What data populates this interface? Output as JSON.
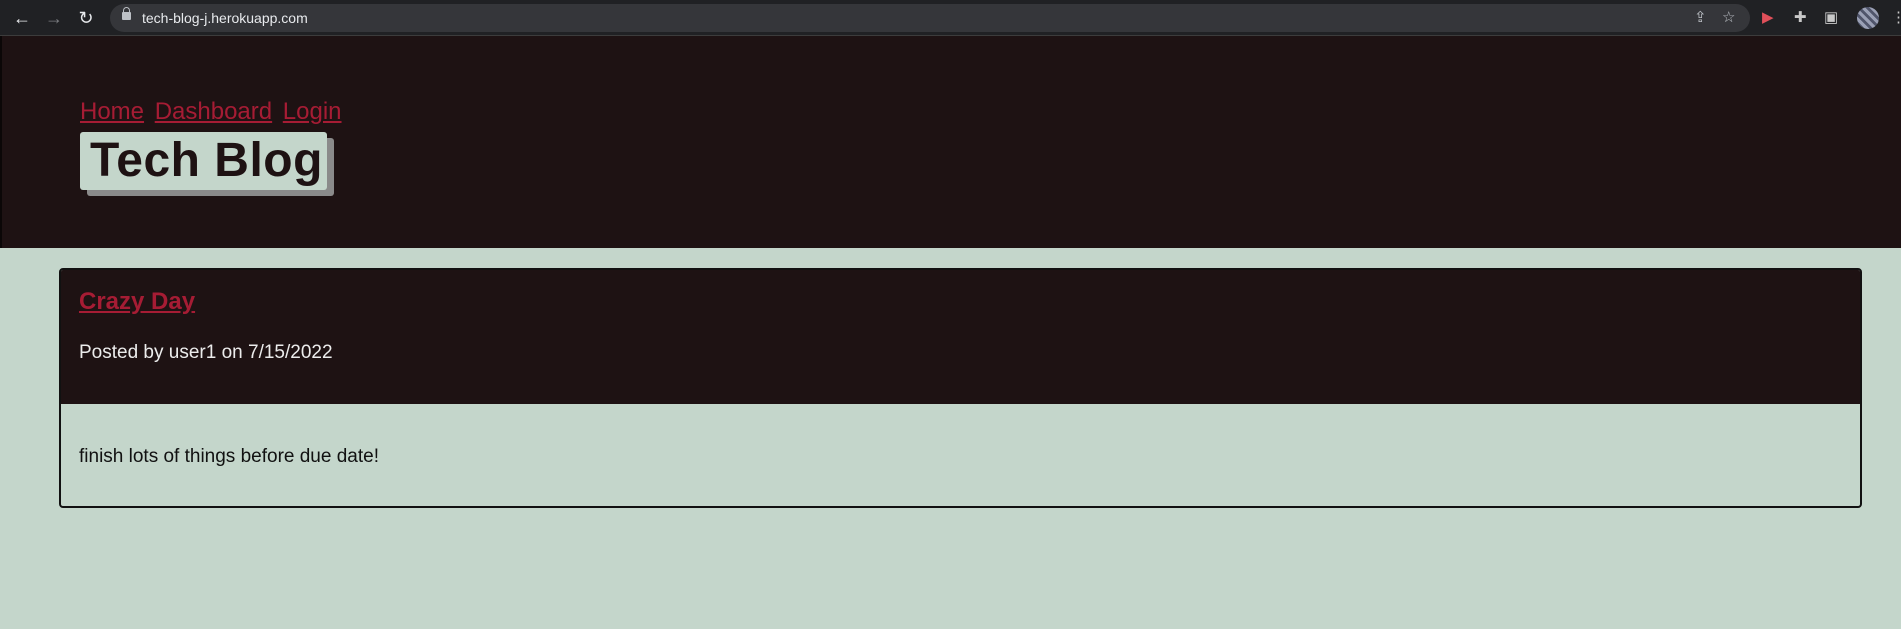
{
  "browser": {
    "url": "tech-blog-j.herokuapp.com",
    "back_icon": "arrow-left-icon",
    "forward_icon": "arrow-right-icon",
    "reload_icon": "reload-icon"
  },
  "header": {
    "nav": [
      {
        "label": "Home"
      },
      {
        "label": "Dashboard"
      },
      {
        "label": "Login"
      }
    ],
    "title": "Tech Blog"
  },
  "posts": [
    {
      "title": "Crazy Day",
      "meta": "Posted by user1 on 7/15/2022",
      "body": "finish lots of things before due date!"
    }
  ],
  "colors": {
    "header_bg": "#1e1213",
    "page_bg": "#c4d6cb",
    "link": "#a61c34"
  }
}
